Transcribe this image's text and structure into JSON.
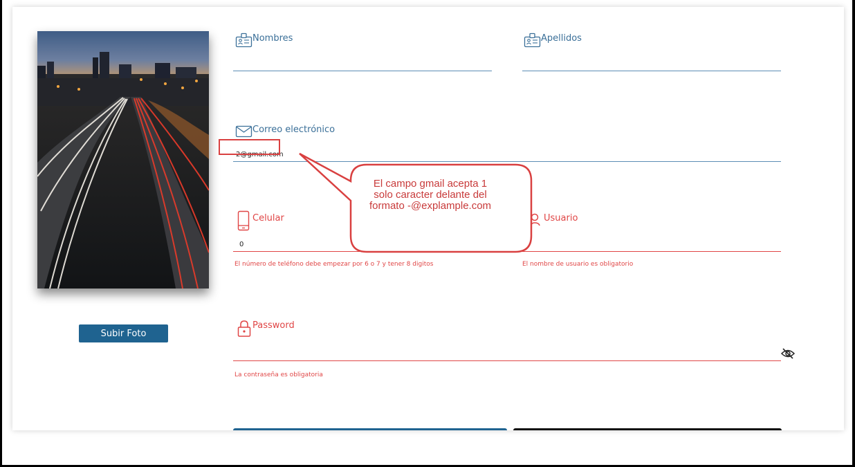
{
  "form": {
    "upload_button": "Subir Foto",
    "nombres": {
      "label": "Nombres",
      "icon": "id-card-icon"
    },
    "apellidos": {
      "label": "Apellidos",
      "icon": "id-card-icon"
    },
    "correo": {
      "label": "Correo electrónico",
      "value": "2@gmail.com",
      "icon": "envelope-icon"
    },
    "celular": {
      "label": "Celular",
      "value": "0",
      "error": "El número de teléfono debe empezar por 6 o 7 y tener 8 digitos",
      "icon": "smartphone-icon"
    },
    "usuario": {
      "label": "Usuario",
      "error": "El nombre de usuario es obligatorio",
      "icon": "user-icon"
    },
    "password": {
      "label": "Password",
      "error": "La contraseña es obligatoria",
      "icon": "lock-icon",
      "toggle_icon": "eye-slash-icon"
    }
  },
  "annotation": {
    "text": "El campo gmail acepta 1\nsolo caracter delante del\nformato -@explample.com"
  },
  "colors": {
    "label_blue": "#3a6f98",
    "error_red": "#e04545",
    "button_blue": "#1f6390",
    "callout_border": "#d94040"
  }
}
